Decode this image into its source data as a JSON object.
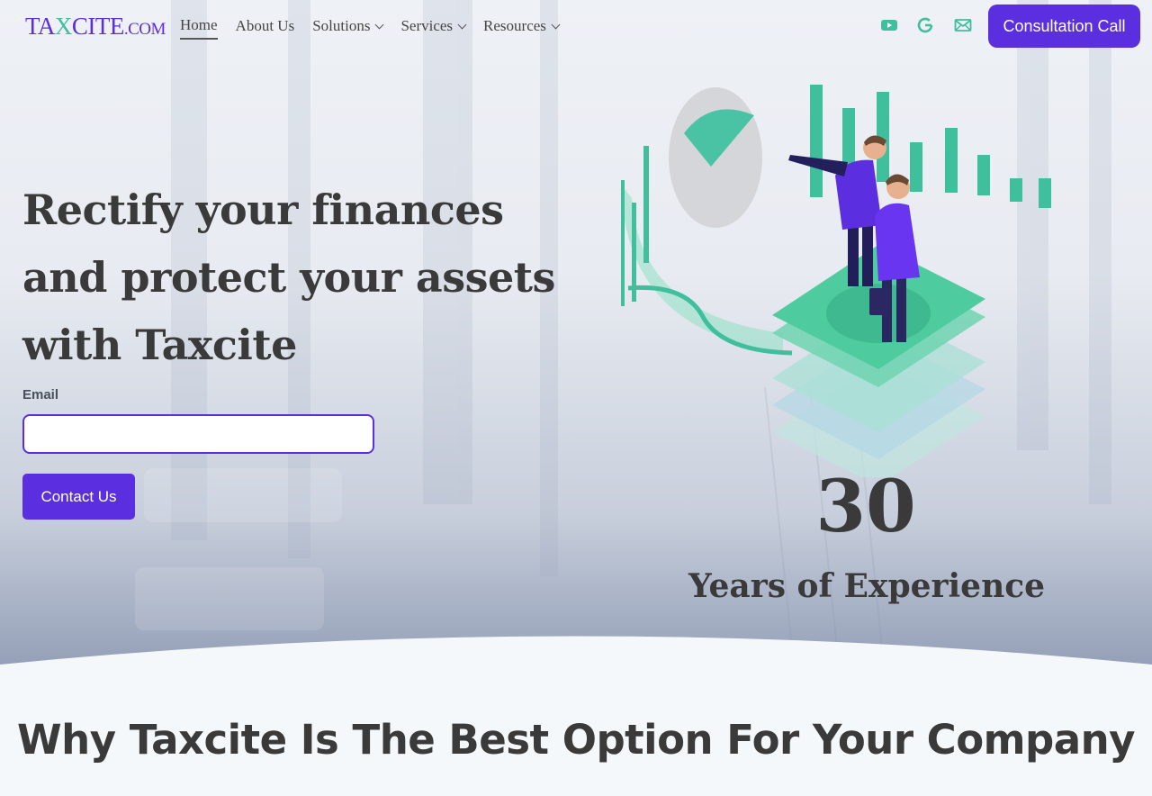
{
  "brand": {
    "logo_prefix": "TA",
    "logo_x": "X",
    "logo_main": "CITE",
    "logo_suffix": ".COM"
  },
  "nav": {
    "items": [
      {
        "label": "Home"
      },
      {
        "label": "About Us"
      },
      {
        "label": "Solutions"
      },
      {
        "label": "Services"
      },
      {
        "label": "Resources"
      }
    ],
    "cta_label": "Consultation Call"
  },
  "social": [
    "youtube-icon",
    "google-icon",
    "mail-icon"
  ],
  "hero": {
    "headline": "Rectify your finances and protect your assets with Taxcite",
    "email_label": "Email",
    "email_value": "",
    "contact_label": "Contact Us",
    "experience_number": "30",
    "experience_label": "Years of Experience"
  },
  "section": {
    "title": "Why Taxcite Is The Best Option For Your Company"
  },
  "colors": {
    "accent": "#5b2ee0",
    "teal": "#3fbf9c",
    "text": "#3a3a3a"
  }
}
